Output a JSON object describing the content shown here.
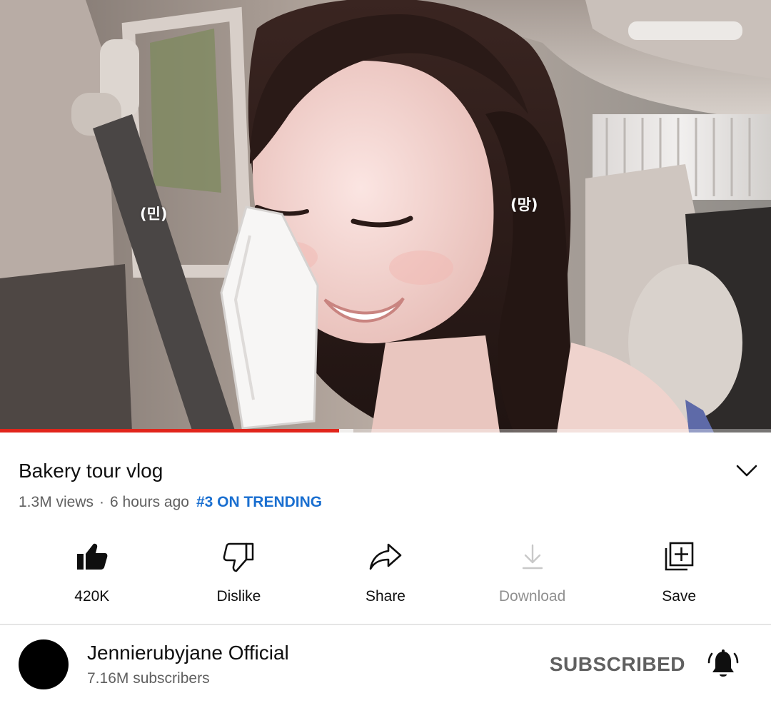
{
  "video": {
    "captions": {
      "left": "(민)",
      "right": "(망)"
    },
    "progress": {
      "played_fraction": 0.44,
      "buffered_fraction": 0.458
    }
  },
  "info": {
    "title": "Bakery tour vlog",
    "views": "1.3M views",
    "separator": "·",
    "age": "6 hours ago",
    "trending": "#3 ON TRENDING",
    "expand_icon": "chevron-down-icon"
  },
  "actions": [
    {
      "icon": "thumbs-up-icon",
      "label": "420K",
      "enabled": true
    },
    {
      "icon": "thumbs-down-icon",
      "label": "Dislike",
      "enabled": true
    },
    {
      "icon": "share-icon",
      "label": "Share",
      "enabled": true
    },
    {
      "icon": "download-icon",
      "label": "Download",
      "enabled": false
    },
    {
      "icon": "add-to-playlist-icon",
      "label": "Save",
      "enabled": true
    }
  ],
  "channel": {
    "name": "Jennierubyjane Official",
    "subscribers": "7.16M subscribers",
    "subscribe_label": "SUBSCRIBED",
    "notification_icon": "bell-icon"
  },
  "colors": {
    "progress_played": "#e1251b",
    "trending_link": "#1a6fd0",
    "secondary_text": "#606060",
    "disabled_text": "#909090"
  }
}
